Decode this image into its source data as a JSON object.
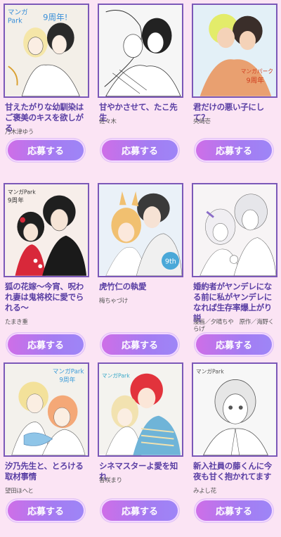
{
  "items": [
    {
      "title": "甘えたがりな幼馴染はご褒美のキスを欲しがる",
      "author": "乃木津ゆう",
      "button": "応募する",
      "tint": "#f3efe8"
    },
    {
      "title": "甘やかさせて、たこ先生",
      "author": "佐々木",
      "button": "応募する",
      "tint": "#f6f6f6"
    },
    {
      "title": "君だけの悪い子にして？",
      "author": "央崎壱",
      "button": "応募する",
      "tint": "#e3f0f7"
    },
    {
      "title": "狐の花嫁～今宵、呪われ妻は鬼将校に愛でられる～",
      "author": "たまき重",
      "button": "応募する",
      "tint": "#f7eeea"
    },
    {
      "title": "虎竹仁の執愛",
      "author": "梅ちゃづけ",
      "button": "応募する",
      "tint": "#eaf1f8"
    },
    {
      "title": "婚約者がヤンデレになる前に私がヤンデレになれば生存率爆上がり説",
      "author": "漫画／夕晴ちや　原作／海野くらげ",
      "button": "応募する",
      "tint": "#f7f4f5"
    },
    {
      "title": "汐乃先生と、とろける取材事情",
      "author": "望田ほへと",
      "button": "応募する",
      "tint": "#f3f1ec"
    },
    {
      "title": "シネマスターよ愛を知れ",
      "author": "香咲まり",
      "button": "応募する",
      "tint": "#f4f3ef"
    },
    {
      "title": "新入社員の藤くんに今夜も甘く抱かれてます",
      "author": "みよし花",
      "button": "応募する",
      "tint": "#f7f7f7"
    }
  ]
}
